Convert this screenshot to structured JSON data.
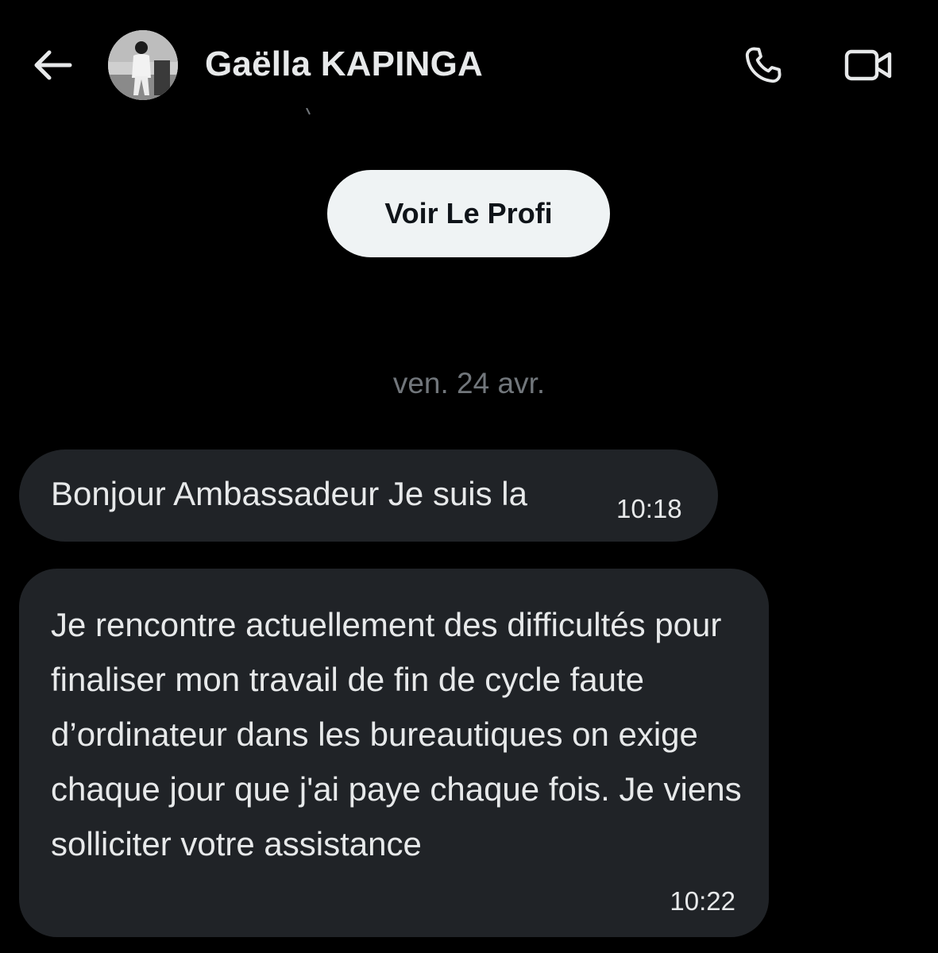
{
  "header": {
    "contact_name": "Gaëlla KAPINGA",
    "back_icon": "arrow-left-icon",
    "call_icon": "phone-icon",
    "video_icon": "video-camera-icon"
  },
  "profile_button": {
    "label": "Voir Le Profi"
  },
  "conversation": {
    "date_separator": "ven. 24 avr.",
    "messages": [
      {
        "text": "Bonjour Ambassadeur Je suis la",
        "time": "10:18"
      },
      {
        "text": "Je rencontre actuellement des difficultés pour finaliser mon travail de fin de cycle faute d’ordinateur dans les bureautiques on exige chaque jour que j'ai paye chaque fois. Je viens solliciter votre assistance",
        "time": "10:22"
      }
    ]
  },
  "colors": {
    "background": "#000000",
    "bubble": "#202327",
    "text": "#e7e9ea",
    "muted": "#71767b",
    "button_bg": "#eff3f4"
  }
}
